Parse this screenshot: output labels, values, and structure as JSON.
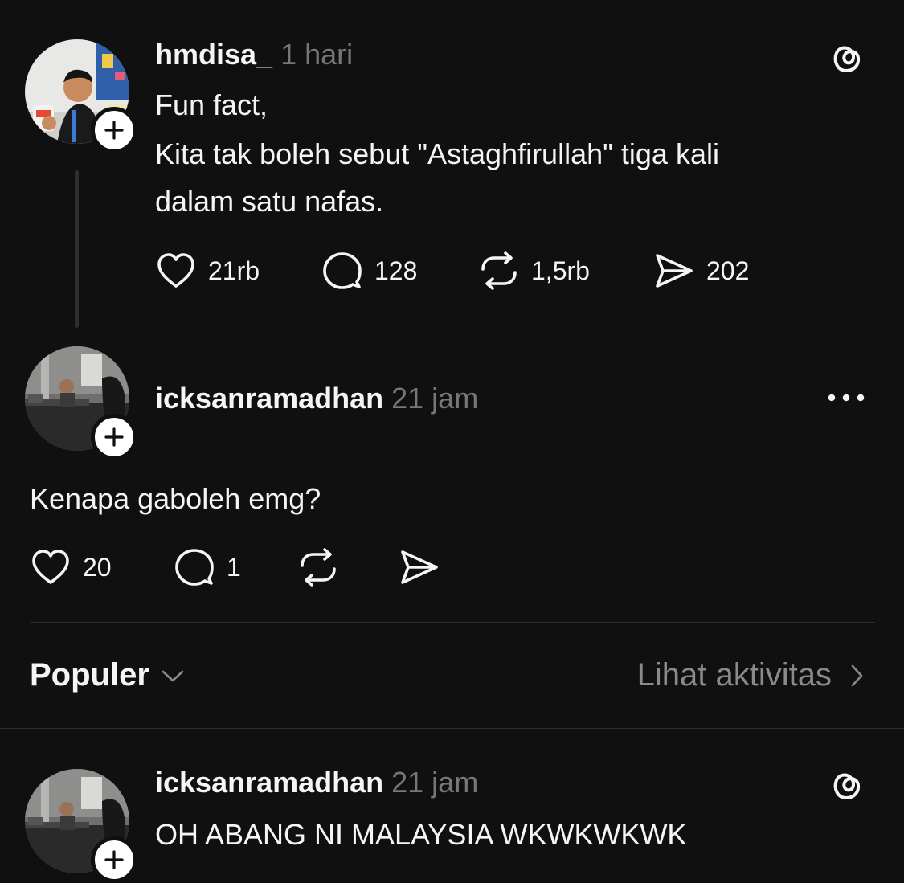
{
  "original_post": {
    "username": "hmdisa_",
    "time": "1 hari",
    "text_lines": [
      "Fun fact,",
      "Kita tak boleh sebut \"Astaghfirullah\" tiga kali",
      "dalam satu nafas."
    ],
    "likes": "21rb",
    "replies": "128",
    "reposts": "1,5rb",
    "shares": "202",
    "corner_icon": "threads-logo-icon"
  },
  "reply_post": {
    "username": "icksanramadhan",
    "time": "21 jam",
    "text": "Kenapa gaboleh emg?",
    "likes": "20",
    "replies": "1",
    "menu_icon": "more-options-icon"
  },
  "popular_bar": {
    "label": "Populer",
    "activity_link": "Lihat aktivitas"
  },
  "bottom_post": {
    "username": "icksanramadhan",
    "time": "21 jam",
    "text": "OH ABANG NI MALAYSIA WKWKWKWK",
    "corner_icon": "threads-logo-icon"
  },
  "colors": {
    "background": "#101010",
    "text_primary": "#f3f5f7",
    "text_secondary": "#777777",
    "divider": "#2c2c2c"
  }
}
